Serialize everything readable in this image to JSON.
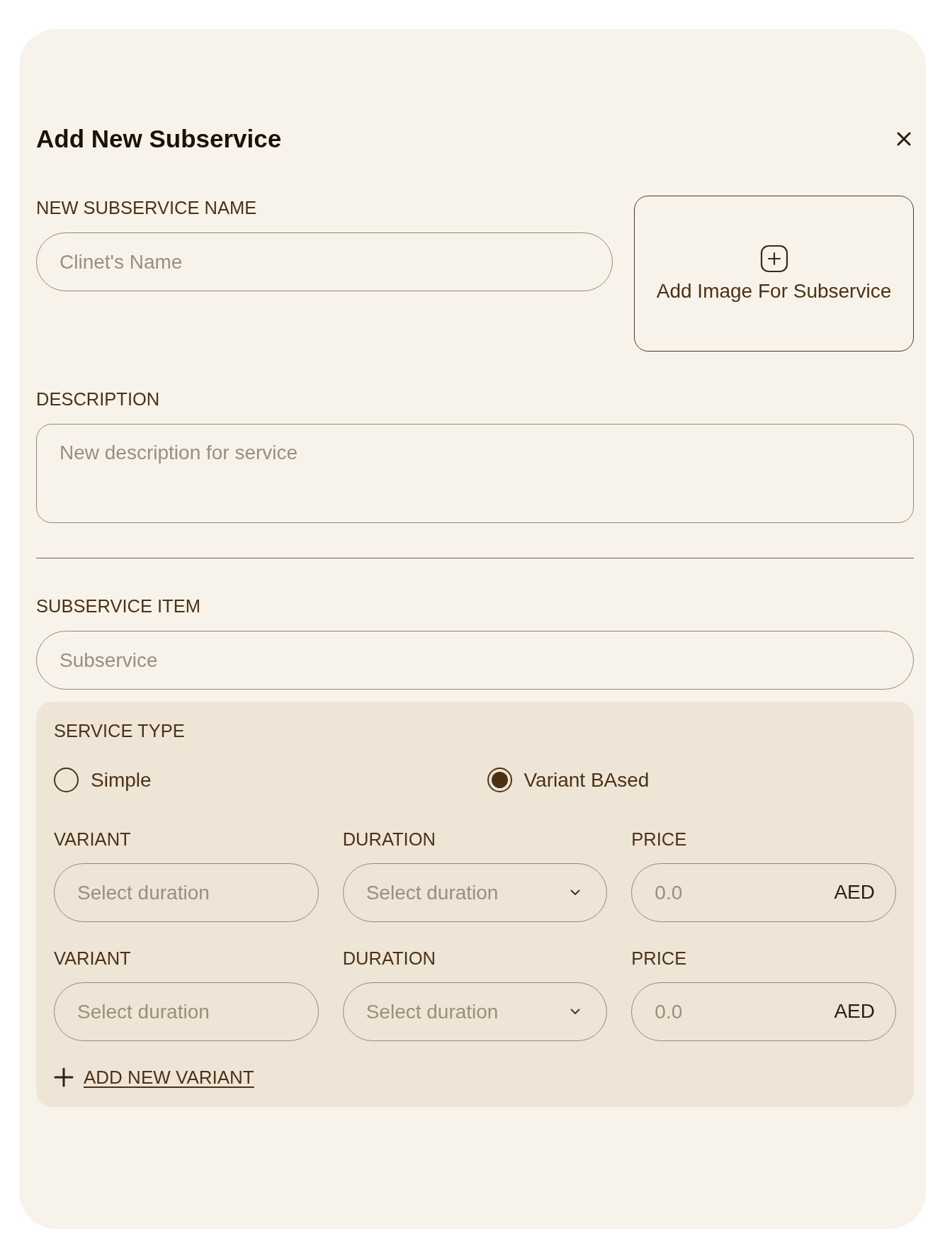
{
  "dialog": {
    "title": "Add New Subservice"
  },
  "name_field": {
    "label": "NEW SUBSERVICE NAME",
    "placeholder": "Clinet's Name"
  },
  "image_upload": {
    "label": "Add Image For Subservice"
  },
  "description_field": {
    "label": "DESCRIPTION",
    "placeholder": "New description for service"
  },
  "subservice_item_field": {
    "label": "SUBSERVICE ITEM",
    "placeholder": "Subservice"
  },
  "service_type": {
    "label": "SERVICE TYPE",
    "options": [
      {
        "label": "Simple",
        "selected": false
      },
      {
        "label": "Variant BAsed",
        "selected": true
      }
    ],
    "variants": [
      {
        "fields": [
          {
            "kind": "text",
            "label": "VARIANT",
            "placeholder": "Select duration"
          },
          {
            "kind": "select",
            "label": "DURATION",
            "placeholder": "Select duration"
          },
          {
            "kind": "price",
            "label": "PRICE",
            "placeholder": "0.0",
            "currency": "AED"
          }
        ]
      },
      {
        "fields": [
          {
            "kind": "text",
            "label": "VARIANT",
            "placeholder": "Select duration"
          },
          {
            "kind": "select",
            "label": "DURATION",
            "placeholder": "Select duration"
          },
          {
            "kind": "price",
            "label": "PRICE",
            "placeholder": "0.0",
            "currency": "AED"
          }
        ]
      }
    ],
    "add_variant": {
      "label": "ADD NEW VARIANT"
    }
  }
}
